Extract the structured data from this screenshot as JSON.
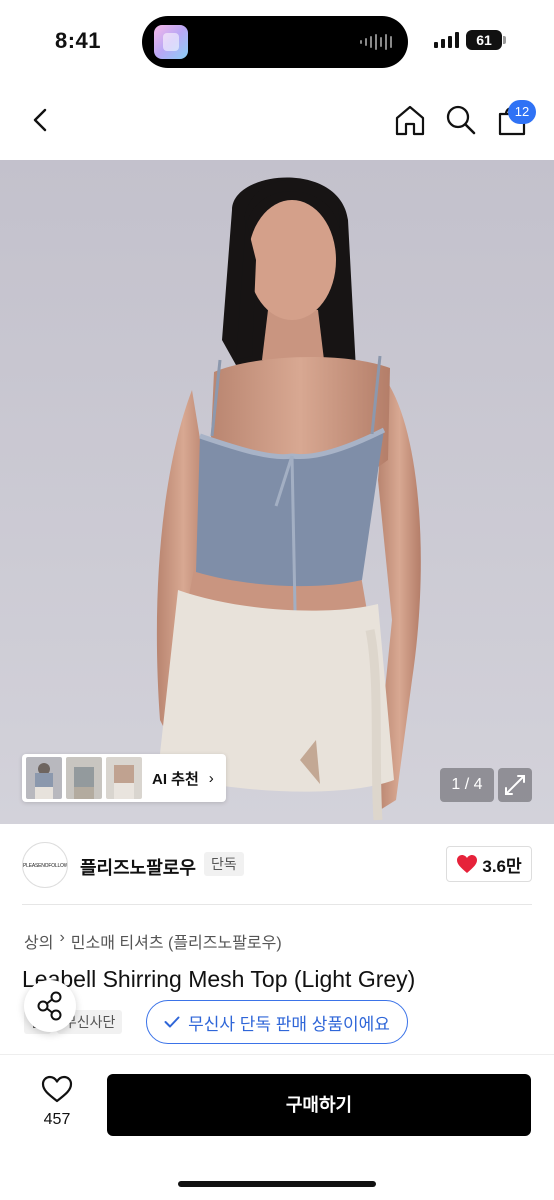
{
  "status_bar": {
    "time": "8:41",
    "battery": "61"
  },
  "header": {
    "back_icon": "chevron-left-icon",
    "home_icon": "home-icon",
    "search_icon": "search-icon",
    "cart_icon": "shopping-bag-icon",
    "cart_count": "12",
    "badge_color": "#2f72f5"
  },
  "gallery": {
    "ai_label": "AI 추천",
    "page_indicator": "1 / 4",
    "expand_icon": "expand-icon"
  },
  "brand": {
    "logo_text": "PLEASENOFOLLOW",
    "name": "플리즈노팔로우",
    "exclusive_tag": "단독",
    "likes": "3.6만",
    "heart_color": "#e6223a"
  },
  "product": {
    "category": [
      "상의",
      "민소매 티셔츠 (플리즈노팔로우)"
    ],
    "title": "Leabell Shirring Mesh Top (Light Grey)",
    "tags": [
      "품",
      "무신사단"
    ]
  },
  "toast": {
    "text": "무신사 단독 판매 상품이에요",
    "color": "#2f66d8"
  },
  "bottom_bar": {
    "wish_count": "457",
    "buy_label": "구매하기"
  }
}
